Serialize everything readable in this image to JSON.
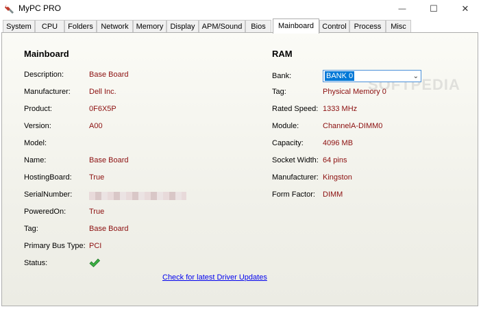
{
  "window": {
    "title": "MyPC PRO",
    "minimize_glyph": "—",
    "maximize_glyph": "☐",
    "close_glyph": "✕"
  },
  "tabs": [
    {
      "label": "System"
    },
    {
      "label": "CPU"
    },
    {
      "label": "Folders"
    },
    {
      "label": "Network"
    },
    {
      "label": "Memory"
    },
    {
      "label": "Display"
    },
    {
      "label": "APM/Sound"
    },
    {
      "label": "Bios"
    },
    {
      "label": "Mainboard"
    },
    {
      "label": "Control"
    },
    {
      "label": "Process"
    },
    {
      "label": "Misc"
    }
  ],
  "active_tab": "Mainboard",
  "mainboard": {
    "title": "Mainboard",
    "rows": [
      {
        "label": "Description:",
        "value": "Base Board"
      },
      {
        "label": "Manufacturer:",
        "value": "Dell Inc."
      },
      {
        "label": "Product:",
        "value": "0F6X5P"
      },
      {
        "label": "Version:",
        "value": "A00"
      },
      {
        "label": "Model:",
        "value": ""
      },
      {
        "label": "Name:",
        "value": "Base Board"
      },
      {
        "label": "HostingBoard:",
        "value": "True"
      },
      {
        "label": "SerialNumber:",
        "value": ""
      },
      {
        "label": "PoweredOn:",
        "value": "True"
      },
      {
        "label": "Tag:",
        "value": "Base Board"
      },
      {
        "label": "Primary Bus Type:",
        "value": "PCI"
      },
      {
        "label": "Status:",
        "value": ""
      }
    ],
    "status_icon": "checkmark-icon"
  },
  "ram": {
    "title": "RAM",
    "bank_label": "Bank:",
    "bank_selected": "BANK 0",
    "rows": [
      {
        "label": "Tag:",
        "value": "Physical Memory 0"
      },
      {
        "label": "Rated Speed:",
        "value": "1333 MHz"
      },
      {
        "label": "Module:",
        "value": "ChannelA-DIMM0"
      },
      {
        "label": "Capacity:",
        "value": "4096 MB"
      },
      {
        "label": "Socket Width:",
        "value": "64 pins"
      },
      {
        "label": "Manufacturer:",
        "value": "Kingston"
      },
      {
        "label": "Form Factor:",
        "value": "DIMM"
      }
    ]
  },
  "link_text": "Check for latest Driver Updates",
  "watermark": "SOFTPEDIA",
  "colors": {
    "value_text": "#8b0e0e",
    "link": "#0000ee",
    "selection": "#0078d7",
    "check": "#3cb043"
  }
}
